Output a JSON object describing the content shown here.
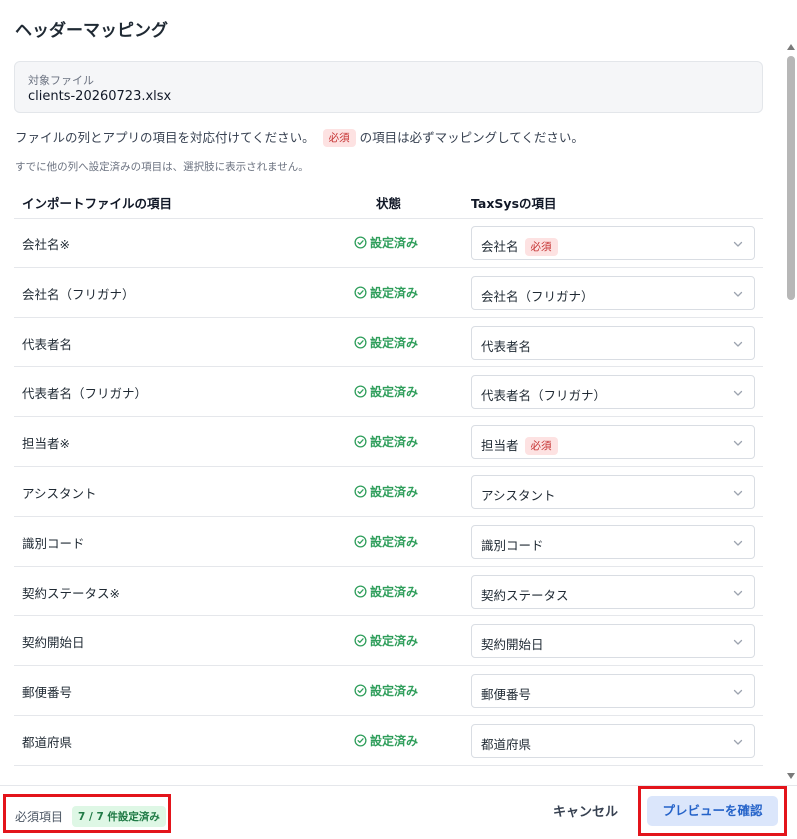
{
  "dialog": {
    "title": "ヘッダーマッピング",
    "file_label": "対象ファイル",
    "file_name": "clients-20260723.xlsx",
    "instruction_prefix": "ファイルの列とアプリの項目を対応付けてください。",
    "required_badge": "必須",
    "instruction_suffix": "の項目は必ずマッピングしてください。",
    "note": "すでに他の列へ設定済みの項目は、選択肢に表示されません。"
  },
  "table": {
    "headers": {
      "import_item": "インポートファイルの項目",
      "status": "状態",
      "taxsys_item": "TaxSysの項目"
    },
    "rows": [
      {
        "name": "会社名※",
        "status": "設定済み",
        "mapped": "会社名",
        "required": "必須"
      },
      {
        "name": "会社名（フリガナ）",
        "status": "設定済み",
        "mapped": "会社名（フリガナ）",
        "required": ""
      },
      {
        "name": "代表者名",
        "status": "設定済み",
        "mapped": "代表者名",
        "required": ""
      },
      {
        "name": "代表者名（フリガナ）",
        "status": "設定済み",
        "mapped": "代表者名（フリガナ）",
        "required": ""
      },
      {
        "name": "担当者※",
        "status": "設定済み",
        "mapped": "担当者",
        "required": "必須"
      },
      {
        "name": "アシスタント",
        "status": "設定済み",
        "mapped": "アシスタント",
        "required": ""
      },
      {
        "name": "識別コード",
        "status": "設定済み",
        "mapped": "識別コード",
        "required": ""
      },
      {
        "name": "契約ステータス※",
        "status": "設定済み",
        "mapped": "契約ステータス",
        "required": ""
      },
      {
        "name": "契約開始日",
        "status": "設定済み",
        "mapped": "契約開始日",
        "required": ""
      },
      {
        "name": "郵便番号",
        "status": "設定済み",
        "mapped": "郵便番号",
        "required": ""
      },
      {
        "name": "都道府県",
        "status": "設定済み",
        "mapped": "都道府県",
        "required": ""
      }
    ]
  },
  "footer": {
    "required_label": "必須項目",
    "required_count": "7 / 7 件設定済み",
    "cancel_label": "キャンセル",
    "confirm_label": "プレビューを確認"
  },
  "colors": {
    "status_green": "#2f9e5b",
    "required_red": "#c53030",
    "primary_blue": "#2563c9",
    "highlight_red": "#e3141b"
  },
  "icons": {
    "status": "check-circle-icon",
    "select": "chevron-down-icon"
  }
}
